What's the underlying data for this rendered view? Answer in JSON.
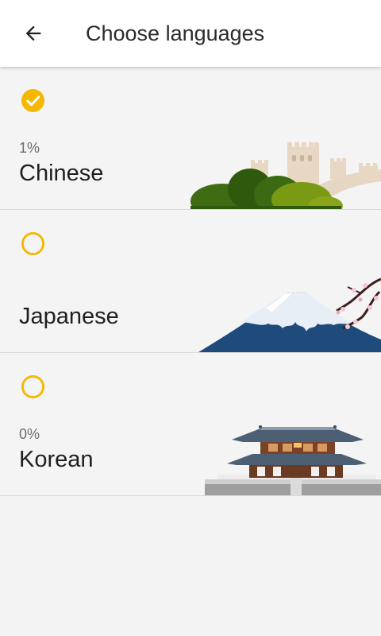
{
  "appbar": {
    "back_icon": "arrow-left-icon",
    "title": "Choose languages"
  },
  "languages": [
    {
      "name": "Chinese",
      "progress": "1%",
      "selected": true,
      "illustration": "great-wall-illustration"
    },
    {
      "name": "Japanese",
      "progress": "",
      "selected": false,
      "illustration": "mount-fuji-illustration"
    },
    {
      "name": "Korean",
      "progress": "0%",
      "selected": false,
      "illustration": "korean-palace-illustration"
    }
  ],
  "colors": {
    "accent": "#f5b800",
    "appbar_bg": "#ffffff",
    "list_bg": "#f4f4f4",
    "divider": "#d8d8d8"
  }
}
